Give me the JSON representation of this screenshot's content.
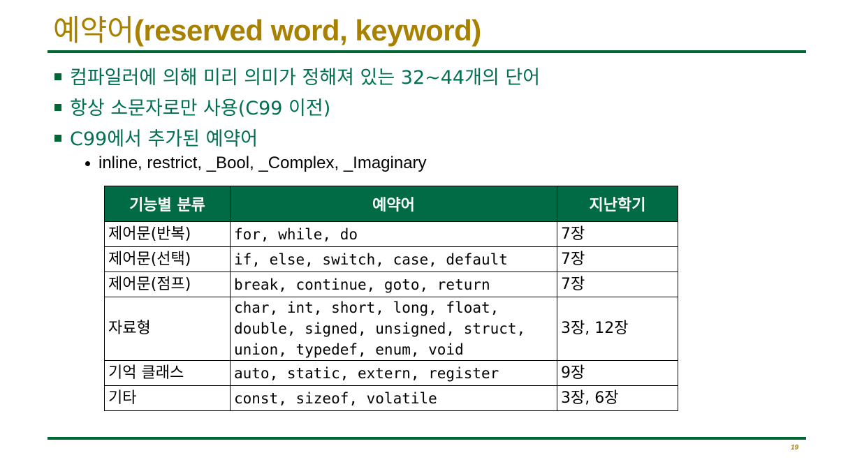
{
  "title": {
    "korean": "예약어",
    "english": "(reserved word, keyword)"
  },
  "bullets": [
    "컴파일러에 의해 미리 의미가 정해져 있는 32~44개의 단어",
    "항상 소문자로만 사용(C99 이전)",
    "C99에서 추가된 예약어"
  ],
  "sub_bullet": "inline, restrict, _Bool, _Complex, _Imaginary",
  "table": {
    "headers": [
      "기능별 분류",
      "예약어",
      "지난학기"
    ],
    "rows": [
      {
        "category": "제어문(반복)",
        "keywords": "for, while, do",
        "chapter": "7장"
      },
      {
        "category": "제어문(선택)",
        "keywords": "if, else, switch, case, default",
        "chapter": "7장"
      },
      {
        "category": "제어문(점프)",
        "keywords": "break, continue, goto, return",
        "chapter": "7장"
      },
      {
        "category": "자료형",
        "keywords": "char, int, short, long, float, double, signed, unsigned, struct, union, typedef, enum, void",
        "chapter": "3장, 12장"
      },
      {
        "category": "기억 클래스",
        "keywords": "auto, static, extern, register",
        "chapter": "9장"
      },
      {
        "category": "기타",
        "keywords": "const, sizeof, volatile",
        "chapter": "3장, 6장"
      }
    ]
  },
  "page_number": "19",
  "colors": {
    "title": "#a98100",
    "accent_green": "#006633",
    "header_green": "#006b45",
    "bullet_text": "#007050"
  }
}
